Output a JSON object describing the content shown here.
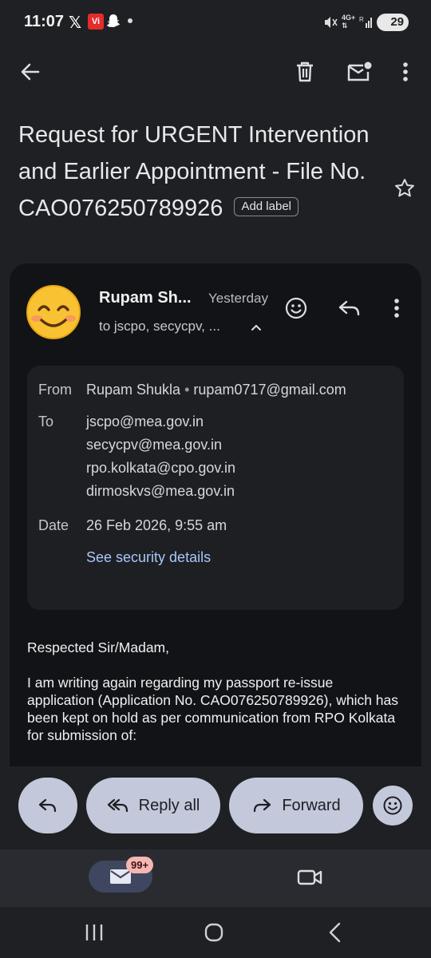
{
  "status_bar": {
    "time": "11:07",
    "x_logo": "𝕏",
    "carrier_badge": "Vi",
    "network": "4G+",
    "network_sub": "R",
    "battery": "29"
  },
  "toolbar": {
    "back_icon": "arrow-left-icon",
    "delete_icon": "trash-icon",
    "mark_unread_icon": "mail-badge-icon",
    "more_icon": "more-vertical-icon"
  },
  "subject": {
    "text": "Request for URGENT Intervention and Earlier Appointment - File No. CAO076250789926",
    "add_label": "Add label"
  },
  "message": {
    "sender_short": "Rupam Sh...",
    "time": "Yesterday",
    "to_summary": "to jscpo, secycpv, ...",
    "details": {
      "from_label": "From",
      "from_name": "Rupam Shukla",
      "from_sep": "•",
      "from_email": "rupam0717@gmail.com",
      "to_label": "To",
      "to": [
        "jscpo@mea.gov.in",
        "secycpv@mea.gov.in",
        "rpo.kolkata@cpo.gov.in",
        "dirmoskvs@mea.gov.in"
      ],
      "date_label": "Date",
      "date": "26 Feb 2026, 9:55 am",
      "security_link": "See security details"
    },
    "body": [
      "Respected Sir/Madam,",
      "I am writing again regarding my passport re-issue application (Application No. CAO076250789926), which has been kept on hold as per communication from RPO Kolkata for submission of:"
    ]
  },
  "actions": {
    "reply_all": "Reply all",
    "forward": "Forward"
  },
  "bottom_nav": {
    "mail_badge": "99+"
  },
  "colors": {
    "background": "#1f2024",
    "card": "#121316",
    "pill": "#c3c8da",
    "link": "#a8c7fa",
    "badge": "#f6b6b1"
  }
}
